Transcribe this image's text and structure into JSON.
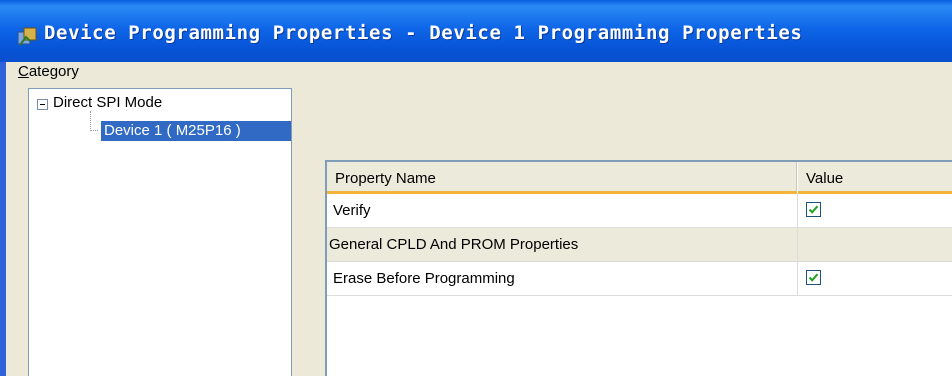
{
  "window": {
    "title": "Device Programming Properties - Device 1 Programming Properties",
    "icon": "device-programming-icon"
  },
  "category": {
    "label_first": "C",
    "label_rest": "ategory"
  },
  "tree": {
    "root_label": "Direct SPI Mode",
    "child_label": "Device 1 ( M25P16 )"
  },
  "grid": {
    "columns": {
      "name": "Property Name",
      "value": "Value"
    },
    "rows": [
      {
        "name": "Verify",
        "checked": true
      },
      {
        "name": "General CPLD And PROM Properties",
        "group": true
      },
      {
        "name": "Erase Before Programming",
        "checked": true
      }
    ]
  },
  "colors": {
    "titlebar": "#0753d6",
    "selection": "#316ac5",
    "header_underline": "#f2b53a",
    "check": "#21a121"
  }
}
